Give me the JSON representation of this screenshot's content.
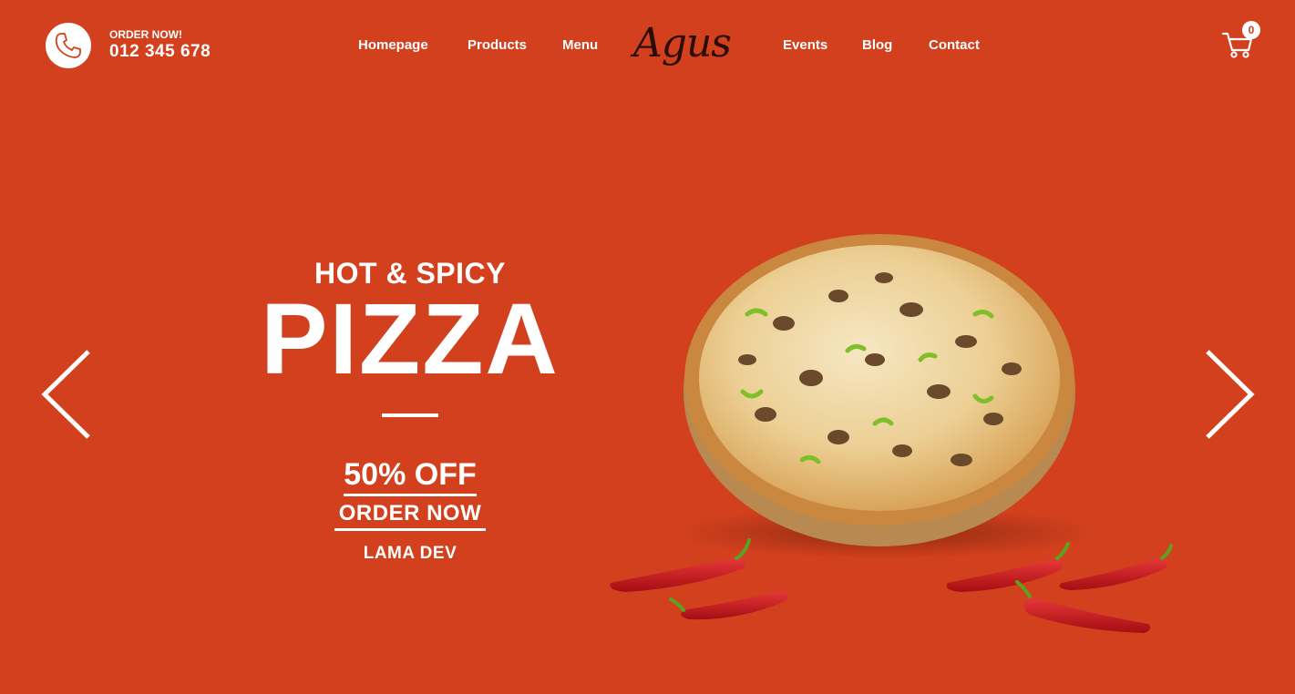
{
  "navbar": {
    "order_label": "ORDER NOW!",
    "phone": "012 345 678",
    "links": [
      "Homepage",
      "Products",
      "Menu",
      "Events",
      "Blog",
      "Contact"
    ],
    "logo_text": "Agus",
    "cart_count": "0"
  },
  "slider": {
    "subtitle": "HOT & SPICY",
    "title": "PIZZA",
    "discount": "50% OFF",
    "cta": "ORDER NOW",
    "brand": "LAMA DEV",
    "prev_icon": "chevron-left-icon",
    "next_icon": "chevron-right-icon"
  },
  "colors": {
    "background": "#d2401e",
    "text": "#ffffff",
    "logo": "#2a0d06"
  }
}
